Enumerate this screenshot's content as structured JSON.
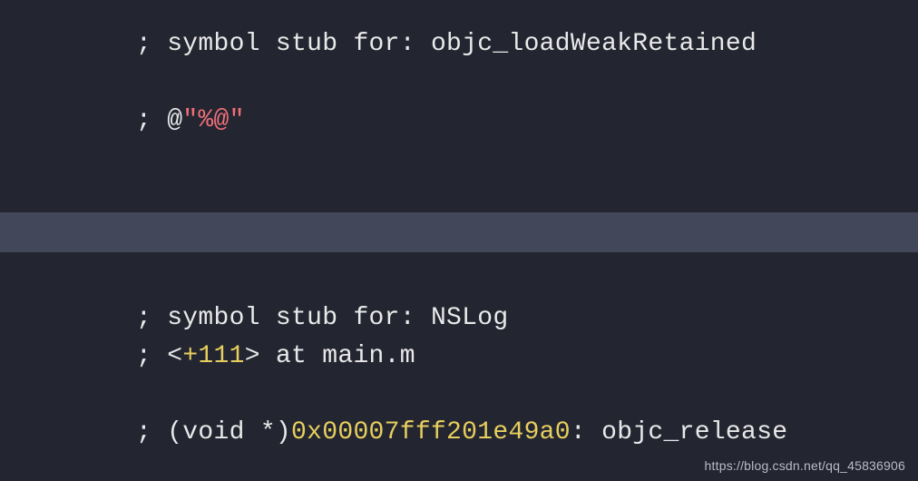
{
  "top": {
    "line1": {
      "prefix": "; symbol stub for: ",
      "target": "objc_loadWeakRetained"
    },
    "line2": {
      "prefix": "; @",
      "string": "\"%@\""
    }
  },
  "bottom": {
    "line1": {
      "prefix": "; symbol stub for: ",
      "target": "NSLog"
    },
    "line2": {
      "prefix": "; <",
      "offset": "+111",
      "suffix": "> at main.m"
    },
    "line3": {
      "prefix": "; (void *)",
      "addr": "0x00007fff201e49a0",
      "suffix": ": objc_release"
    }
  },
  "watermark": "https://blog.csdn.net/qq_45836906"
}
